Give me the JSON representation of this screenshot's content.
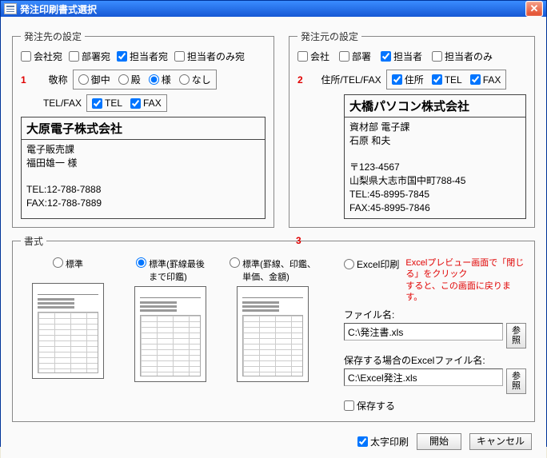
{
  "window": {
    "title": "発注印刷書式選択"
  },
  "dest": {
    "legend": "発注先の設定",
    "chk_company": "会社宛",
    "chk_dept": "部署宛",
    "chk_person": "担当者宛",
    "chk_person_only": "担当者のみ宛",
    "num": "1",
    "honorific_label": "敬称",
    "honorific_opts": {
      "onchu": "御中",
      "dono": "殿",
      "sama": "様",
      "none": "なし"
    },
    "telfax_label": "TEL/FAX",
    "telfax_opts": {
      "tel": "TEL",
      "fax": "FAX"
    },
    "company_header": "大原電子株式会社",
    "company_body": "電子販売課\n福田雄一 様\n\nTEL:12-788-7888\nFAX:12-788-7889"
  },
  "src": {
    "legend": "発注元の設定",
    "chk_company": "会社",
    "chk_dept": "部署",
    "chk_person": "担当者",
    "chk_person_only": "担当者のみ",
    "num": "2",
    "addr_label": "住所/TEL/FAX",
    "addr_opts": {
      "addr": "住所",
      "tel": "TEL",
      "fax": "FAX"
    },
    "company_header": "大橋パソコン株式会社",
    "company_body": "資材部 電子課\n石原 和夫\n\n〒123-4567\n山梨県大志市国中町788-45\nTEL:45-8995-7845\nFAX:45-8995-7846"
  },
  "format": {
    "legend": "書式",
    "num": "3",
    "opt_standard": "標準",
    "opt_std_stamp": "標準(罫線最後\nまで印鑑)",
    "opt_std_ruled": "標準(罫線、印鑑、\n単価、金額)",
    "opt_excel": "Excel印刷",
    "excel_note": "Excelプレビュー画面で「閉じる」をクリック\nすると、この画面に戻ります。",
    "file_label": "ファイル名:",
    "file_value": "C:\\発注書.xls",
    "save_label": "保存する場合のExcelファイル名:",
    "save_value": "C:\\Excel発注.xls",
    "browse_btn": "参\n照",
    "chk_save": "保存する"
  },
  "footer": {
    "chk_bold": "太字印刷",
    "btn_start": "開始",
    "btn_cancel": "キャンセル"
  }
}
